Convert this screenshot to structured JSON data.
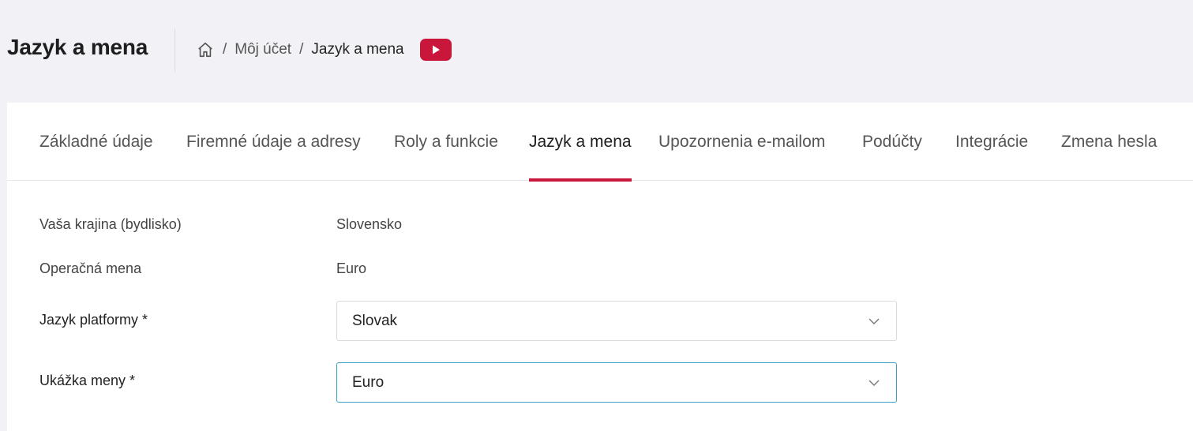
{
  "header": {
    "title": "Jazyk a mena",
    "breadcrumb": {
      "home_icon": "home-icon",
      "separator": "/",
      "items": [
        "Môj účet",
        "Jazyk a mena"
      ]
    },
    "video_icon": "youtube-play-icon",
    "accent_color": "#c8173b"
  },
  "tabs": [
    {
      "label": "Základné údaje"
    },
    {
      "label": "Firemné údaje a adresy"
    },
    {
      "label": "Roly a funkcie"
    },
    {
      "label": "Jazyk a mena",
      "active": true
    },
    {
      "label": "Upozornenia e-mailom"
    },
    {
      "label": "Podúčty"
    },
    {
      "label": "Integrácie"
    },
    {
      "label": "Zmena hesla"
    }
  ],
  "form": {
    "country": {
      "label": "Vaša krajina (bydlisko)",
      "value": "Slovensko"
    },
    "currency": {
      "label": "Operačná mena",
      "value": "Euro"
    },
    "platform_language": {
      "label": "Jazyk platformy *",
      "selected": "Slovak"
    },
    "currency_preview": {
      "label": "Ukážka meny *",
      "selected": "Euro"
    }
  }
}
